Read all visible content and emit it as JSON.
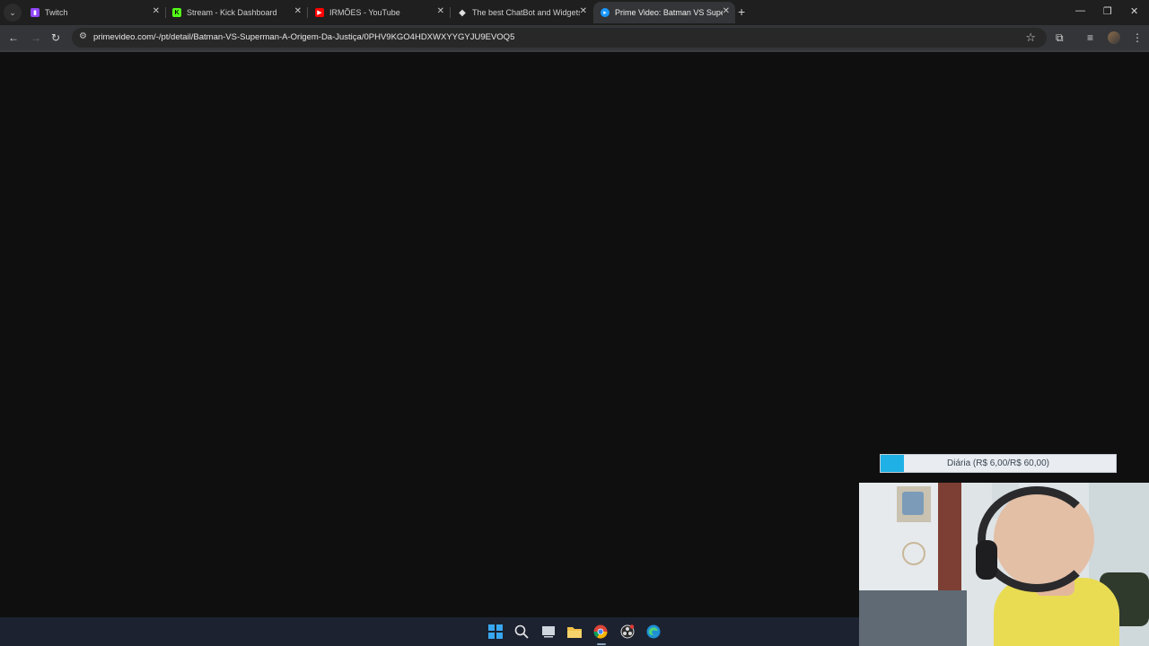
{
  "browser": {
    "tabs": [
      {
        "title": "Twitch",
        "icon": "twitch-icon",
        "color": "#9146ff",
        "active": false
      },
      {
        "title": "Stream - Kick Dashboard",
        "icon": "kick-icon",
        "color": "#53fc18",
        "active": false
      },
      {
        "title": "IRMÕES - YouTube",
        "icon": "youtube-icon",
        "color": "#ff0000",
        "active": false
      },
      {
        "title": "The best ChatBot and Widgets",
        "icon": "streamelements-icon",
        "color": "#e0e0e0",
        "active": false
      },
      {
        "title": "Prime Video: Batman VS Superm",
        "icon": "prime-video-icon",
        "color": "#1a98ff",
        "active": true
      }
    ],
    "new_tab_label": "+",
    "address_bar": {
      "url": "primevideo.com/-/pt/detail/Batman-VS-Superman-A-Origem-Da-Justiça/0PHV9KGO4HDXWXYYGYJU9EVOQ5"
    }
  },
  "overlay": {
    "goal_label": "Diária (R$ 6,00/R$ 60,00)",
    "goal_progress": 0.1,
    "goal_color": "#1fb1e6"
  },
  "taskbar": {
    "items": [
      "windows-start-icon",
      "search-icon",
      "task-view-icon",
      "file-explorer-icon",
      "chrome-icon",
      "obs-icon",
      "edge-icon"
    ]
  }
}
